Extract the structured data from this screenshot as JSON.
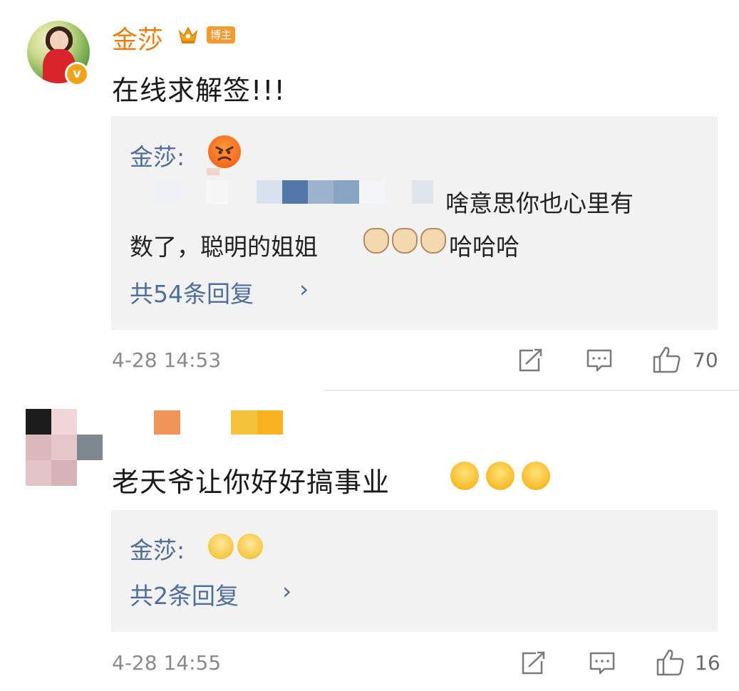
{
  "comment1": {
    "username": "金莎",
    "badge_label": "博主",
    "text": "在线求解签!!!",
    "reply": {
      "name": "金莎:",
      "text_line1": "啥意思你也心里有",
      "text_line2": "数了，聪明的姐姐",
      "text_line2_suffix": "哈哈哈",
      "more_link": "共54条回复",
      "chevron": "›"
    },
    "timestamp": "4-28 14:53",
    "like_count": "70"
  },
  "comment2": {
    "text": "老天爷让你好好搞事业",
    "reply": {
      "name": "金莎:",
      "more_link": "共2条回复",
      "chevron": "›"
    },
    "timestamp": "4-28 14:55",
    "like_count": "16"
  },
  "icons": {
    "repost": "repost-icon",
    "comment": "comment-icon",
    "like": "thumbs-up-icon"
  },
  "colors": {
    "username": "#e97f12",
    "link_blue": "#4f6e9a",
    "reply_bg": "#f2f2f2",
    "meta_gray": "#8a8a8a"
  }
}
